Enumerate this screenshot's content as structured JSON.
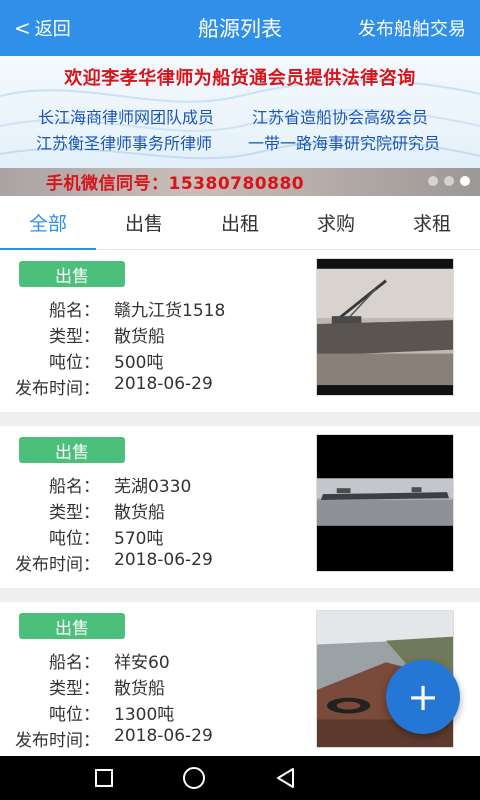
{
  "header": {
    "back_label": "返回",
    "title": "船源列表",
    "publish_label": "发布船舶交易"
  },
  "banner": {
    "headline": "欢迎李孝华律师为船货通会员提供法律咨询",
    "line_left_1": "长江海商律师网团队成员",
    "line_right_1": "江苏省造船协会高级会员",
    "line_left_2": "江苏衡圣律师事务所律师",
    "line_right_2": "一带一路海事研究院研究员",
    "phone": "手机微信同号：15380780880",
    "slide_count": 3,
    "active_slide": 3
  },
  "tabs": [
    {
      "label": "全部",
      "active": true
    },
    {
      "label": "出售",
      "active": false
    },
    {
      "label": "出租",
      "active": false
    },
    {
      "label": "求购",
      "active": false
    },
    {
      "label": "求租",
      "active": false
    }
  ],
  "field_labels": {
    "name": "船名：",
    "type": "类型：",
    "tonnage": "吨位：",
    "date": "发布时间："
  },
  "listings": [
    {
      "tag": "出售",
      "name": "赣九江货1518",
      "type": "散货船",
      "tonnage": "500吨",
      "date": "2018-06-29",
      "photo": "barge-crane-photo"
    },
    {
      "tag": "出售",
      "name": "芜湖0330",
      "type": "散货船",
      "tonnage": "570吨",
      "date": "2018-06-29",
      "photo": "barge-river-photo"
    },
    {
      "tag": "出售",
      "name": "祥安60",
      "type": "散货船",
      "tonnage": "1300吨",
      "date": "2018-06-29",
      "photo": "deck-shore-photo"
    }
  ],
  "fab": {
    "icon": "plus-icon",
    "label": "+"
  },
  "colors": {
    "header_blue": "#2f8fe9",
    "badge_green": "#4cc07b",
    "fab_blue": "#2577d6",
    "banner_red": "#d8141b",
    "banner_blue": "#1a55b7"
  }
}
